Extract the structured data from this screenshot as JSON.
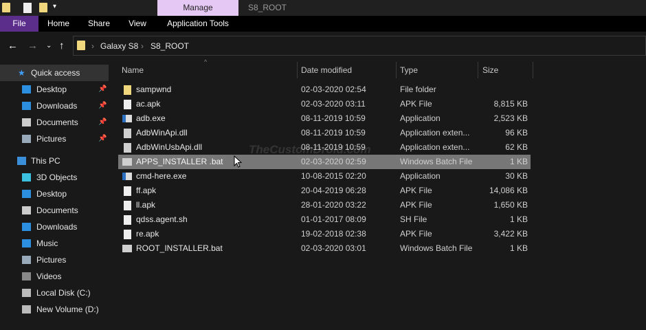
{
  "window": {
    "title": "S8_ROOT",
    "context_tab": "Manage"
  },
  "ribbon": {
    "tabs": [
      "File",
      "Home",
      "Share",
      "View",
      "Application Tools"
    ]
  },
  "address": {
    "crumbs": [
      "Galaxy S8",
      "S8_ROOT"
    ]
  },
  "sidebar": {
    "items": [
      {
        "label": "Quick access",
        "icon": "star-icon",
        "selected": true
      },
      {
        "label": "Desktop",
        "icon": "desktop-icon",
        "pinned": true
      },
      {
        "label": "Downloads",
        "icon": "download-icon",
        "pinned": true
      },
      {
        "label": "Documents",
        "icon": "documents-icon",
        "pinned": true
      },
      {
        "label": "Pictures",
        "icon": "pictures-icon",
        "pinned": true
      },
      {
        "label": "This PC",
        "icon": "computer-icon"
      },
      {
        "label": "3D Objects",
        "icon": "cube-icon"
      },
      {
        "label": "Desktop",
        "icon": "desktop-icon"
      },
      {
        "label": "Documents",
        "icon": "documents-icon"
      },
      {
        "label": "Downloads",
        "icon": "download-icon"
      },
      {
        "label": "Music",
        "icon": "music-icon"
      },
      {
        "label": "Pictures",
        "icon": "pictures-icon"
      },
      {
        "label": "Videos",
        "icon": "videos-icon"
      },
      {
        "label": "Local Disk (C:)",
        "icon": "drive-icon"
      },
      {
        "label": "New Volume (D:)",
        "icon": "drive-icon"
      }
    ]
  },
  "columns": [
    "Name",
    "Date modified",
    "Type",
    "Size"
  ],
  "files": [
    {
      "name": "sampwnd",
      "date": "02-03-2020 02:54",
      "type": "File folder",
      "size": "",
      "icon": "folder-icon"
    },
    {
      "name": "ac.apk",
      "date": "02-03-2020 03:11",
      "type": "APK File",
      "size": "8,815 KB",
      "icon": "file-icon"
    },
    {
      "name": "adb.exe",
      "date": "08-11-2019 10:59",
      "type": "Application",
      "size": "2,523 KB",
      "icon": "app-icon"
    },
    {
      "name": "AdbWinApi.dll",
      "date": "08-11-2019 10:59",
      "type": "Application exten...",
      "size": "96 KB",
      "icon": "dll-icon"
    },
    {
      "name": "AdbWinUsbApi.dll",
      "date": "08-11-2019 10:59",
      "type": "Application exten...",
      "size": "62 KB",
      "icon": "dll-icon"
    },
    {
      "name": "APPS_INSTALLER .bat",
      "date": "02-03-2020 02:59",
      "type": "Windows Batch File",
      "size": "1 KB",
      "icon": "batch-icon",
      "selected": true
    },
    {
      "name": "cmd-here.exe",
      "date": "10-08-2015 02:20",
      "type": "Application",
      "size": "30 KB",
      "icon": "app-icon"
    },
    {
      "name": "ff.apk",
      "date": "20-04-2019 06:28",
      "type": "APK File",
      "size": "14,086 KB",
      "icon": "file-icon"
    },
    {
      "name": "ll.apk",
      "date": "28-01-2020 03:22",
      "type": "APK File",
      "size": "1,650 KB",
      "icon": "file-icon"
    },
    {
      "name": "qdss.agent.sh",
      "date": "01-01-2017 08:09",
      "type": "SH File",
      "size": "1 KB",
      "icon": "file-icon"
    },
    {
      "name": "re.apk",
      "date": "19-02-2018 02:38",
      "type": "APK File",
      "size": "3,422 KB",
      "icon": "file-icon"
    },
    {
      "name": "ROOT_INSTALLER.bat",
      "date": "02-03-2020 03:01",
      "type": "Windows Batch File",
      "size": "1 KB",
      "icon": "batch-icon"
    }
  ],
  "watermark": "TheCustomDroid.com",
  "colors": {
    "file_tab": "#5b2e8c",
    "manage_tab": "#e6c8f5",
    "selection": "#777777"
  }
}
